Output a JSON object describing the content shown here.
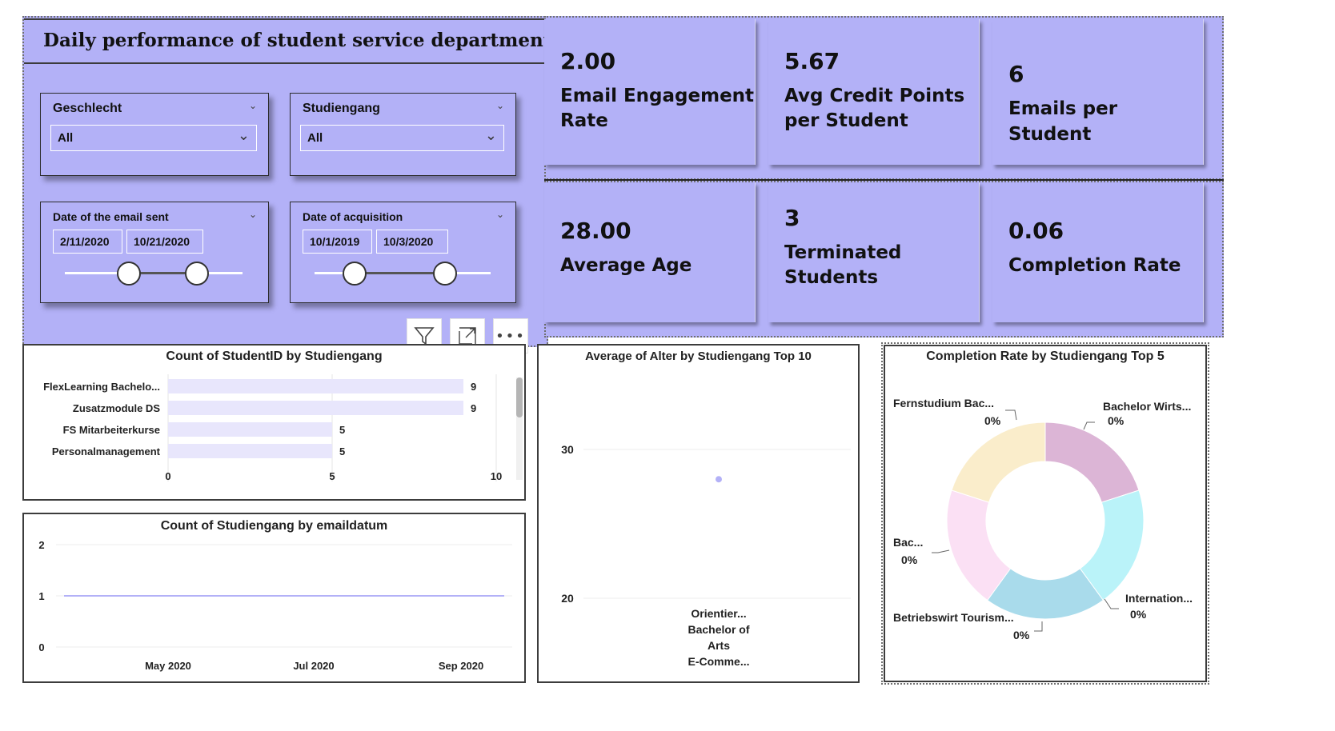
{
  "header": {
    "title": "Daily performance of student service department"
  },
  "slicers": {
    "geschlecht": {
      "label": "Geschlecht",
      "value": "All"
    },
    "studiengang": {
      "label": "Studiengang",
      "value": "All"
    },
    "email_date": {
      "label": "Date of the email sent",
      "start": "2/11/2020",
      "end": "10/21/2020"
    },
    "acq_date": {
      "label": "Date of acquisition",
      "start": "10/1/2019",
      "end": "10/3/2020"
    }
  },
  "icons": {
    "filter": "filter-icon",
    "focus": "focus-mode-icon",
    "more": "more-options-icon",
    "chevron": "chevron-down-icon"
  },
  "kpis": {
    "email_engagement": {
      "value": "2.00",
      "label_1": "Email Engagement",
      "label_2": "Rate"
    },
    "avg_credit": {
      "value": "5.67",
      "label_1": "Avg Credit Points",
      "label_2": "per Student"
    },
    "emails_per_student": {
      "value": "6",
      "label_1": "Emails per Student"
    },
    "average_age": {
      "value": "28.00",
      "label_1": "Average Age"
    },
    "terminated": {
      "value": "3",
      "label_1": "Terminated",
      "label_2": "Students"
    },
    "completion_rate": {
      "value": "0.06",
      "label_1": "Completion Rate"
    }
  },
  "colors": {
    "accent": "#b3b1f7",
    "bar": "#e8e6fc",
    "line": "#b3b1f7"
  },
  "chart_data": [
    {
      "type": "bar",
      "title": "Count of StudentID by Studiengang",
      "categories": [
        "FlexLearning Bachelo...",
        "Zusatzmodule DS",
        "FS Mitarbeiterkurse",
        "Personalmanagement"
      ],
      "values": [
        9,
        9,
        5,
        5
      ],
      "xlim": [
        0,
        10
      ],
      "xticks": [
        "0",
        "5",
        "10"
      ],
      "grid": true
    },
    {
      "type": "line",
      "title": "Count of Studiengang by emaildatum",
      "x": [
        "May 2020",
        "Jul 2020",
        "Sep 2020"
      ],
      "yticks": [
        "0",
        "1",
        "2"
      ],
      "ylim": [
        0,
        2
      ],
      "series": [
        {
          "values": [
            1,
            1,
            1
          ]
        }
      ],
      "grid": true
    },
    {
      "type": "scatter",
      "title": "Average of Alter by Studiengang Top 10",
      "yticks": [
        "20",
        "30"
      ],
      "ylim": [
        18,
        32
      ],
      "points": [
        {
          "value": 28
        }
      ],
      "xlabels": [
        "Orientier...",
        "Bachelor of",
        "Arts",
        "E-Comme..."
      ],
      "grid": true
    },
    {
      "type": "pie",
      "title": "Completion Rate by Studiengang Top 5",
      "slices": [
        {
          "label": "Bachelor Wirts...",
          "pct": "0%",
          "share": 0.2,
          "color": "#dcb5d6"
        },
        {
          "label": "Internation...",
          "pct": "0%",
          "share": 0.2,
          "color": "#baf3f9"
        },
        {
          "label": "Betriebswirt Tourism...",
          "pct": "0%",
          "share": 0.2,
          "color": "#a9dbeb"
        },
        {
          "label": "Bac...",
          "pct": "0%",
          "share": 0.2,
          "color": "#fbe0f4"
        },
        {
          "label": "Fernstudium Bac...",
          "pct": "0%",
          "share": 0.2,
          "color": "#faedcb"
        }
      ]
    }
  ]
}
